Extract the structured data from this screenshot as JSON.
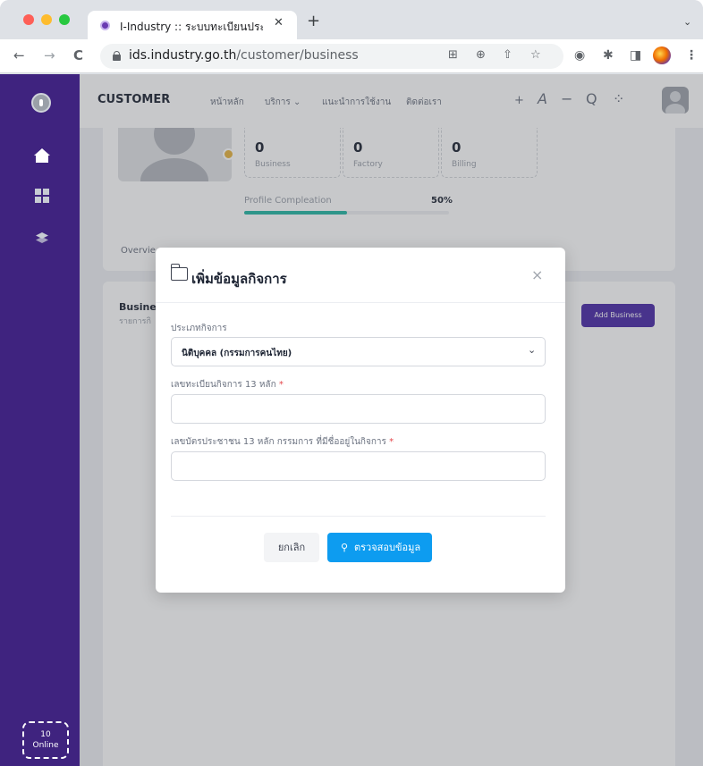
{
  "browser": {
    "tab_title": "I-Industry :: ระบบทะเบียนประวัติผู",
    "tab_close": "✕",
    "new_tab": "+",
    "tab_menu": "⌄",
    "url_host": "ids.industry.go.th",
    "url_path": "/customer/business",
    "back": "←",
    "forward": "→",
    "reload": "C"
  },
  "sidebar": {
    "online_count": "10",
    "online_label": "Online"
  },
  "topbar": {
    "brand": "CUSTOMER",
    "menu": [
      "หน้าหลัก",
      "บริการ ⌄",
      "แนะนำการใช้งาน",
      "ติดต่อเรา"
    ],
    "actions": [
      "+",
      "A",
      "−",
      "Q",
      "⁘"
    ]
  },
  "profile": {
    "stats": [
      {
        "value": "0",
        "label": "Business"
      },
      {
        "value": "0",
        "label": "Factory"
      },
      {
        "value": "0",
        "label": "Billing"
      }
    ],
    "progress_label": "Profile Compleation",
    "progress_value": "50%",
    "progress_fraction": 0.5,
    "progress_color": "#25b7a4",
    "tab_overview": "Overvie"
  },
  "business": {
    "title": "Busine",
    "subtitle": "รายการกิ",
    "add_button": "Add Business"
  },
  "modal": {
    "title": "เพิ่มข้อมูลกิจการ",
    "close": "×",
    "type_label": "ประเภทกิจการ",
    "type_value": "นิติบุคคล (กรรมการคนไทย)",
    "reg_label": "เลขทะเบียนกิจการ 13 หลัก",
    "reg_value": "",
    "id_label": "เลขบัตรประชาชน 13 หลัก กรรมการ ที่มีชื่ออยู่ในกิจการ",
    "id_value": "",
    "required_mark": "*",
    "cancel_label": "ยกเลิก",
    "check_label": "ตรวจสอบข้อมูล",
    "accent": "#0d9cf0"
  }
}
